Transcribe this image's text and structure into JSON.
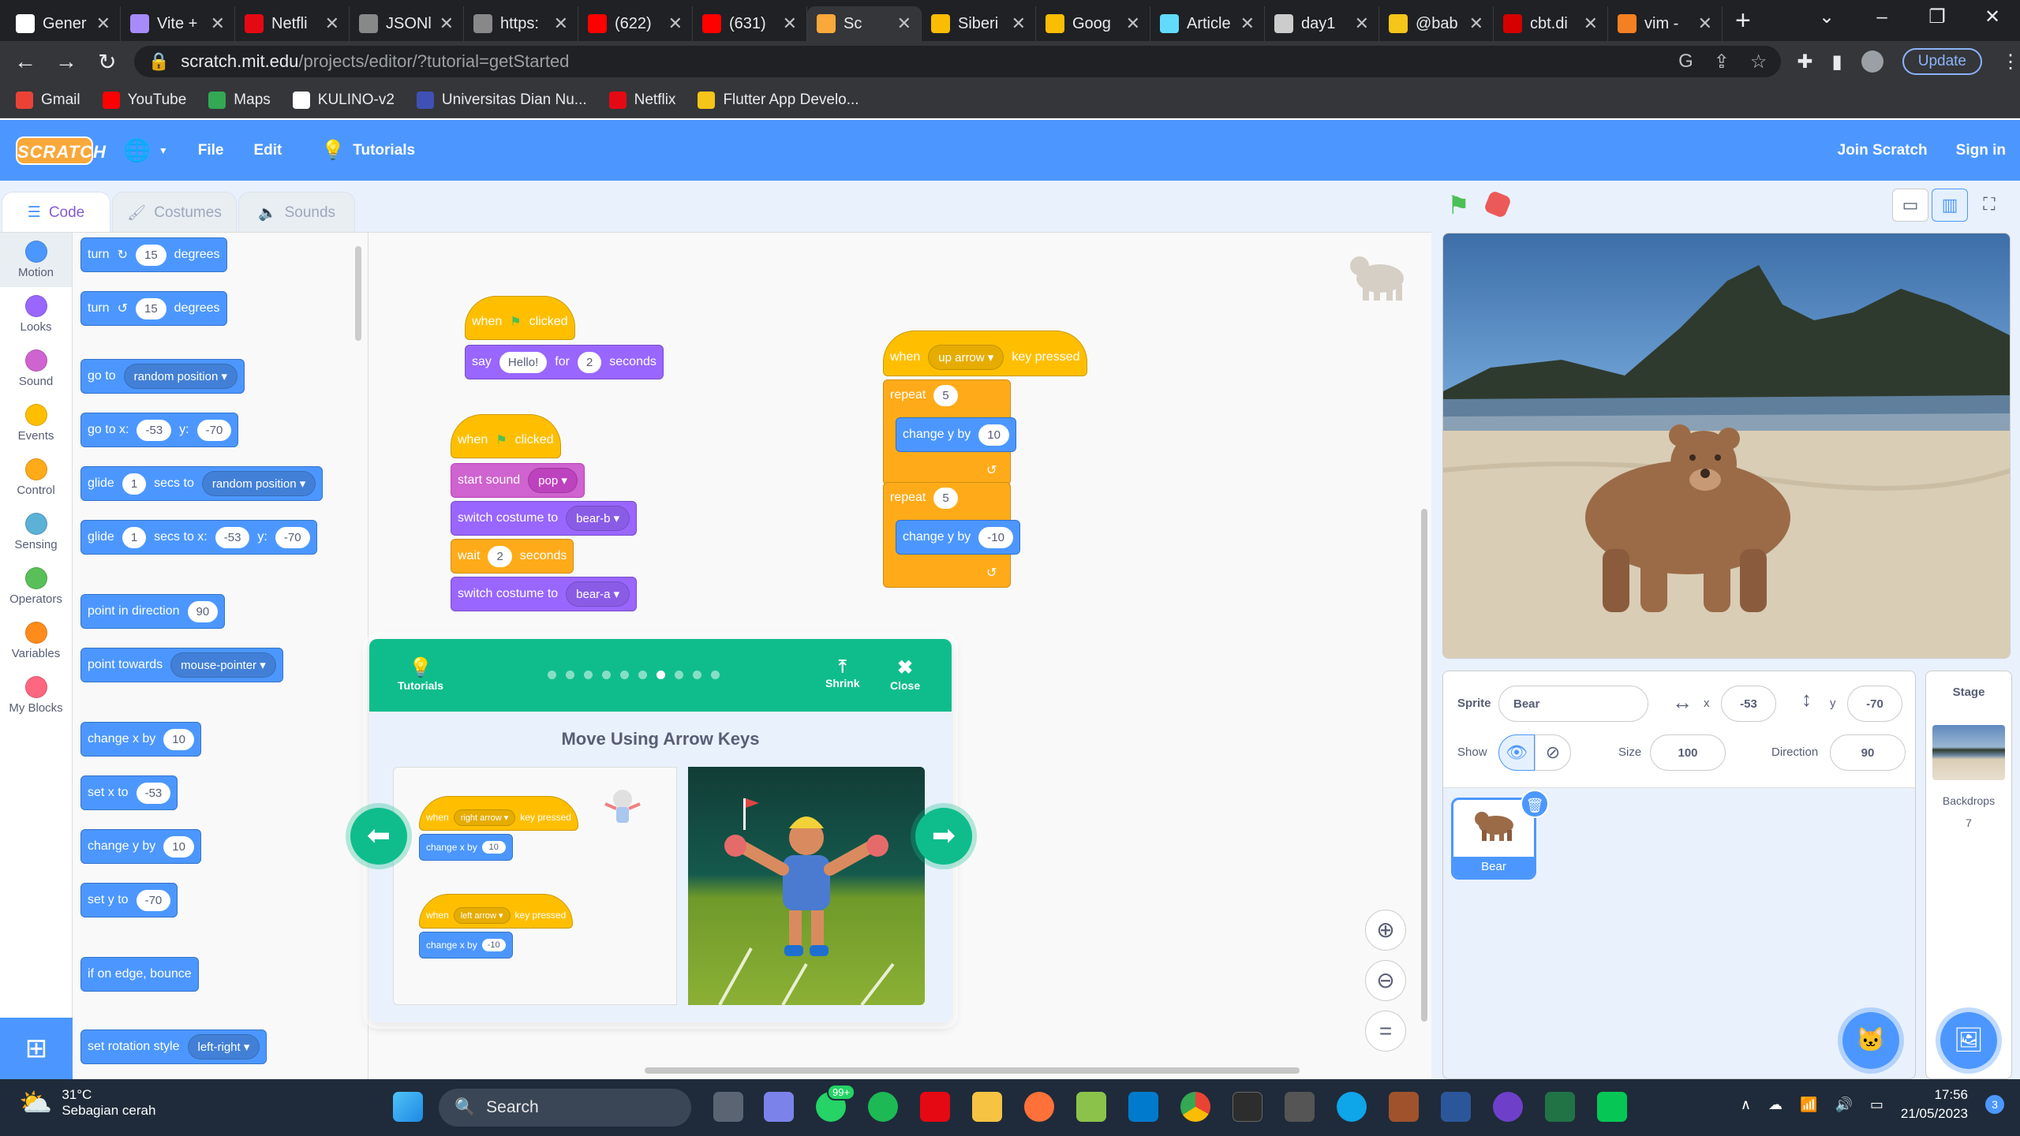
{
  "browser": {
    "tabs": [
      {
        "label": "Gener",
        "color": "#ffffff",
        "icon": "github-icon"
      },
      {
        "label": "Vite +",
        "color": "#a78bfa",
        "icon": "vite-icon"
      },
      {
        "label": "Netfli",
        "color": "#e50914",
        "icon": "netflix-icon"
      },
      {
        "label": "JSONl",
        "color": "#888888",
        "icon": "json-icon"
      },
      {
        "label": "https:",
        "color": "#888888",
        "icon": "page-icon"
      },
      {
        "label": "(622)",
        "color": "#ff0000",
        "icon": "youtube-icon"
      },
      {
        "label": "(631)",
        "color": "#ff0000",
        "icon": "youtube-icon"
      },
      {
        "label": "Sc",
        "color": "#f9a83a",
        "icon": "scratch-icon"
      },
      {
        "label": "Siberi",
        "color": "#fbbc04",
        "icon": "drive-icon"
      },
      {
        "label": "Goog",
        "color": "#fbbc04",
        "icon": "drive-icon"
      },
      {
        "label": "Article",
        "color": "#61dafb",
        "icon": "react-icon"
      },
      {
        "label": "day1",
        "color": "#cccccc",
        "icon": "globe-icon"
      },
      {
        "label": "@bab",
        "color": "#f5c518",
        "icon": "bold-icon"
      },
      {
        "label": "cbt.di",
        "color": "#d50000",
        "icon": "k-icon"
      },
      {
        "label": "vim -",
        "color": "#f48024",
        "icon": "stackoverflow-icon"
      }
    ],
    "url_host": "scratch.mit.edu",
    "url_path": "/projects/editor/?tutorial=getStarted",
    "update_label": "Update",
    "bookmarks": [
      {
        "label": "Gmail",
        "color": "#ea4335"
      },
      {
        "label": "YouTube",
        "color": "#ff0000"
      },
      {
        "label": "Maps",
        "color": "#34a853"
      },
      {
        "label": "KULINO-v2",
        "color": "#ffffff"
      },
      {
        "label": "Universitas Dian Nu...",
        "color": "#3f51b5"
      },
      {
        "label": "Netflix",
        "color": "#e50914"
      },
      {
        "label": "Flutter App Develo...",
        "color": "#f5c518"
      }
    ]
  },
  "scratch": {
    "logo": "SCRATCH",
    "menu": {
      "file": "File",
      "edit": "Edit",
      "tutorials": "Tutorials",
      "join": "Join Scratch",
      "signin": "Sign in"
    },
    "tabs": {
      "code": "Code",
      "costumes": "Costumes",
      "sounds": "Sounds"
    },
    "categories": [
      {
        "label": "Motion",
        "color": "#4c97ff"
      },
      {
        "label": "Looks",
        "color": "#9966ff"
      },
      {
        "label": "Sound",
        "color": "#cf63cf"
      },
      {
        "label": "Events",
        "color": "#ffbf00"
      },
      {
        "label": "Control",
        "color": "#ffab19"
      },
      {
        "label": "Sensing",
        "color": "#5cb1d6"
      },
      {
        "label": "Operators",
        "color": "#59c059"
      },
      {
        "label": "Variables",
        "color": "#ff8c1a"
      },
      {
        "label": "My Blocks",
        "color": "#ff6680"
      }
    ],
    "palette": {
      "turn": "turn",
      "degrees": "degrees",
      "turn_val": "15",
      "goto": "go to",
      "random_position": "random position",
      "goto_x": "go to x:",
      "y": "y:",
      "x_val": "-53",
      "y_val": "-70",
      "glide": "glide",
      "secs_to": "secs to",
      "glide_val": "1",
      "secs_to_x": "secs to x:",
      "point_dir": "point in direction",
      "dir_val": "90",
      "point_towards": "point towards",
      "mouse_pointer": "mouse-pointer",
      "change_x": "change x by",
      "change_val": "10",
      "set_x": "set x to",
      "change_y": "change y by",
      "set_y": "set y to",
      "bounce": "if on edge, bounce",
      "rotation": "set rotation style",
      "rotation_val": "left-right"
    },
    "scripts": {
      "when": "when",
      "clicked": "clicked",
      "say": "say",
      "say_val": "Hello!",
      "for": "for",
      "say_secs": "2",
      "seconds": "seconds",
      "start_sound": "start sound",
      "sound_val": "pop",
      "switch_costume": "switch costume to",
      "costume_b": "bear-b",
      "costume_a": "bear-a",
      "wait": "wait",
      "wait_val": "2",
      "key": "up arrow",
      "key_pressed": "key pressed",
      "repeat": "repeat",
      "repeat_val": "5",
      "change_y": "change y by",
      "plus": "10",
      "minus": "-10"
    },
    "tutorial": {
      "header_label": "Tutorials",
      "shrink": "Shrink",
      "close": "Close",
      "title": "Move Using Arrow Keys",
      "page_count": 10,
      "current_page": 7,
      "ex_when": "when",
      "ex_right": "right arrow",
      "ex_left": "left arrow",
      "ex_key_pressed": "key pressed",
      "ex_change_x": "change x by",
      "ex_plus": "10",
      "ex_minus": "-10"
    },
    "sprite": {
      "label": "Sprite",
      "name": "Bear",
      "x_label": "x",
      "x": "-53",
      "y_label": "y",
      "y": "-70",
      "show": "Show",
      "size_label": "Size",
      "size": "100",
      "direction_label": "Direction",
      "direction": "90",
      "tile_name": "Bear"
    },
    "stage_pane": {
      "title": "Stage",
      "backdrops": "Backdrops",
      "count": "7"
    }
  },
  "taskbar": {
    "temp": "31°C",
    "weather": "Sebagian cerah",
    "search": "Search",
    "whatsapp_badge": "99+",
    "time": "17:56",
    "date": "21/05/2023",
    "notif": "3"
  }
}
